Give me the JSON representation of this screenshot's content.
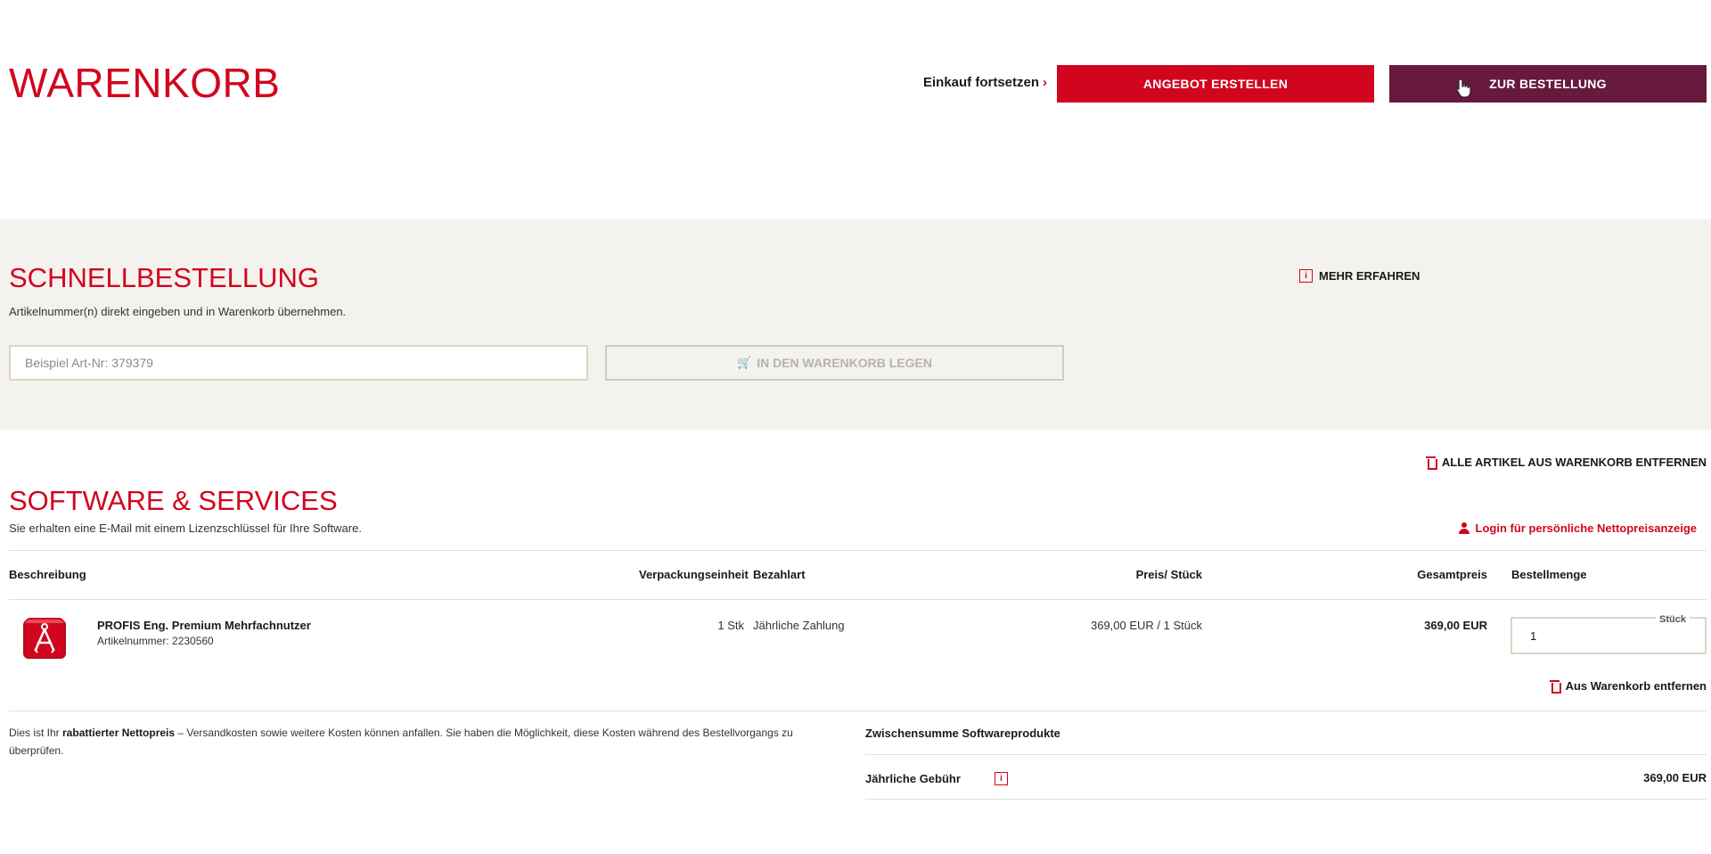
{
  "header": {
    "title": "WARENKORB",
    "continue_label": "Einkauf fortsetzen",
    "continue_chevron": "›",
    "offer_button": "ANGEBOT ERSTELLEN",
    "order_button": "ZUR BESTELLUNG"
  },
  "quick_order": {
    "title": "SCHNELLBESTELLUNG",
    "description": "Artikelnummer(n) direkt eingeben und in Warenkorb übernehmen.",
    "more_info": "MEHR ERFAHREN",
    "input_placeholder": "Beispiel Art-Nr: 379379",
    "add_to_cart": "IN DEN WARENKORB LEGEN"
  },
  "cart": {
    "remove_all": "ALLE ARTIKEL AUS WARENKORB ENTFERNEN",
    "section_title": "SOFTWARE & SERVICES",
    "section_desc": "Sie erhalten eine E-Mail mit einem Lizenzschlüssel für Ihre Software.",
    "login_link": "Login für persönliche Nettopreisanzeige",
    "columns": {
      "description": "Beschreibung",
      "packaging": "Verpackungseinheit",
      "payment": "Bezahlart",
      "unit_price": "Preis/ Stück",
      "total": "Gesamtpreis",
      "quantity": "Bestellmenge"
    },
    "items": [
      {
        "name": "PROFIS Eng. Premium Mehrfachnutzer",
        "article_no": "Artikelnummer: 2230560",
        "packaging": "1 Stk",
        "payment": "Jährliche Zahlung",
        "unit_price": "369,00 EUR / 1 Stück",
        "total": "369,00 EUR",
        "quantity": "1",
        "quantity_unit": "Stück",
        "remove": "Aus Warenkorb entfernen"
      }
    ],
    "note_prefix": "Dies ist Ihr ",
    "note_bold": "rabattierter Nettopreis",
    "note_suffix": " – Versandkosten sowie weitere Kosten können anfallen. Sie haben die Möglichkeit, diese Kosten während des Bestellvorgangs zu überprüfen.",
    "subtotal_label": "Zwischensumme Softwareprodukte",
    "annual_fee_label": "Jährliche Gebühr",
    "annual_fee_value": "369,00 EUR"
  },
  "colors": {
    "brand_red": "#d2051e",
    "order_purple": "#671a3d",
    "quick_bg": "#f4f2ee"
  }
}
